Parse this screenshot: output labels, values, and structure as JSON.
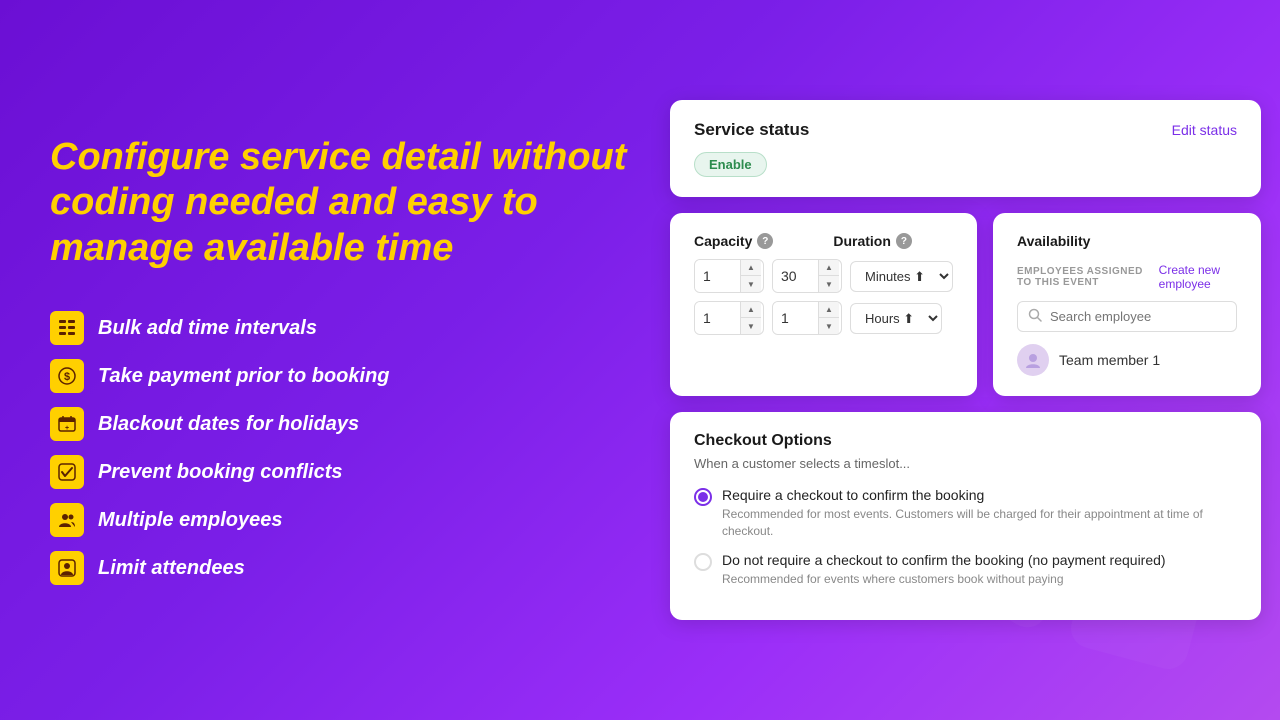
{
  "background": {
    "gradient": "linear-gradient(135deg, #6B0FD4, #9B2EF8, #B44AF0)"
  },
  "hero": {
    "title": "Configure service detail without coding needed and easy to manage available time"
  },
  "features": [
    {
      "id": "bulk-add",
      "icon": "⊞",
      "text": "Bulk add time intervals"
    },
    {
      "id": "payment",
      "icon": "$",
      "text": "Take payment prior to booking"
    },
    {
      "id": "blackout",
      "icon": "🗓",
      "text": "Blackout dates for holidays"
    },
    {
      "id": "conflicts",
      "icon": "✓",
      "text": "Prevent booking conflicts"
    },
    {
      "id": "employees",
      "icon": "👥",
      "text": "Multiple employees"
    },
    {
      "id": "attendees",
      "icon": "👤",
      "text": "Limit attendees"
    }
  ],
  "service_status": {
    "title": "Service status",
    "edit_label": "Edit status",
    "status_badge": "Enable"
  },
  "capacity_duration": {
    "capacity_label": "Capacity",
    "duration_label": "Duration",
    "row1": {
      "capacity_value": "1",
      "duration_value": "30",
      "duration_unit": "Minutes"
    },
    "row2": {
      "capacity_value": "1",
      "duration_value": "1",
      "duration_unit": "Hours"
    },
    "unit_options": [
      "Minutes",
      "Hours"
    ]
  },
  "availability": {
    "title": "Availability",
    "employees_label": "EMPLOYEES ASSIGNED TO THIS EVENT",
    "create_link": "Create new employee",
    "search_placeholder": "Search employee",
    "team_member": "Team member 1"
  },
  "checkout": {
    "title": "Checkout Options",
    "subtitle": "When a customer selects a timeslot...",
    "options": [
      {
        "id": "require-checkout",
        "selected": true,
        "label": "Require a checkout to confirm the booking",
        "description": "Recommended for most events. Customers will be charged for their appointment at time of checkout."
      },
      {
        "id": "no-checkout",
        "selected": false,
        "label": "Do not require a checkout to confirm the booking (no payment required)",
        "description": "Recommended for events where customers book without paying"
      }
    ]
  }
}
